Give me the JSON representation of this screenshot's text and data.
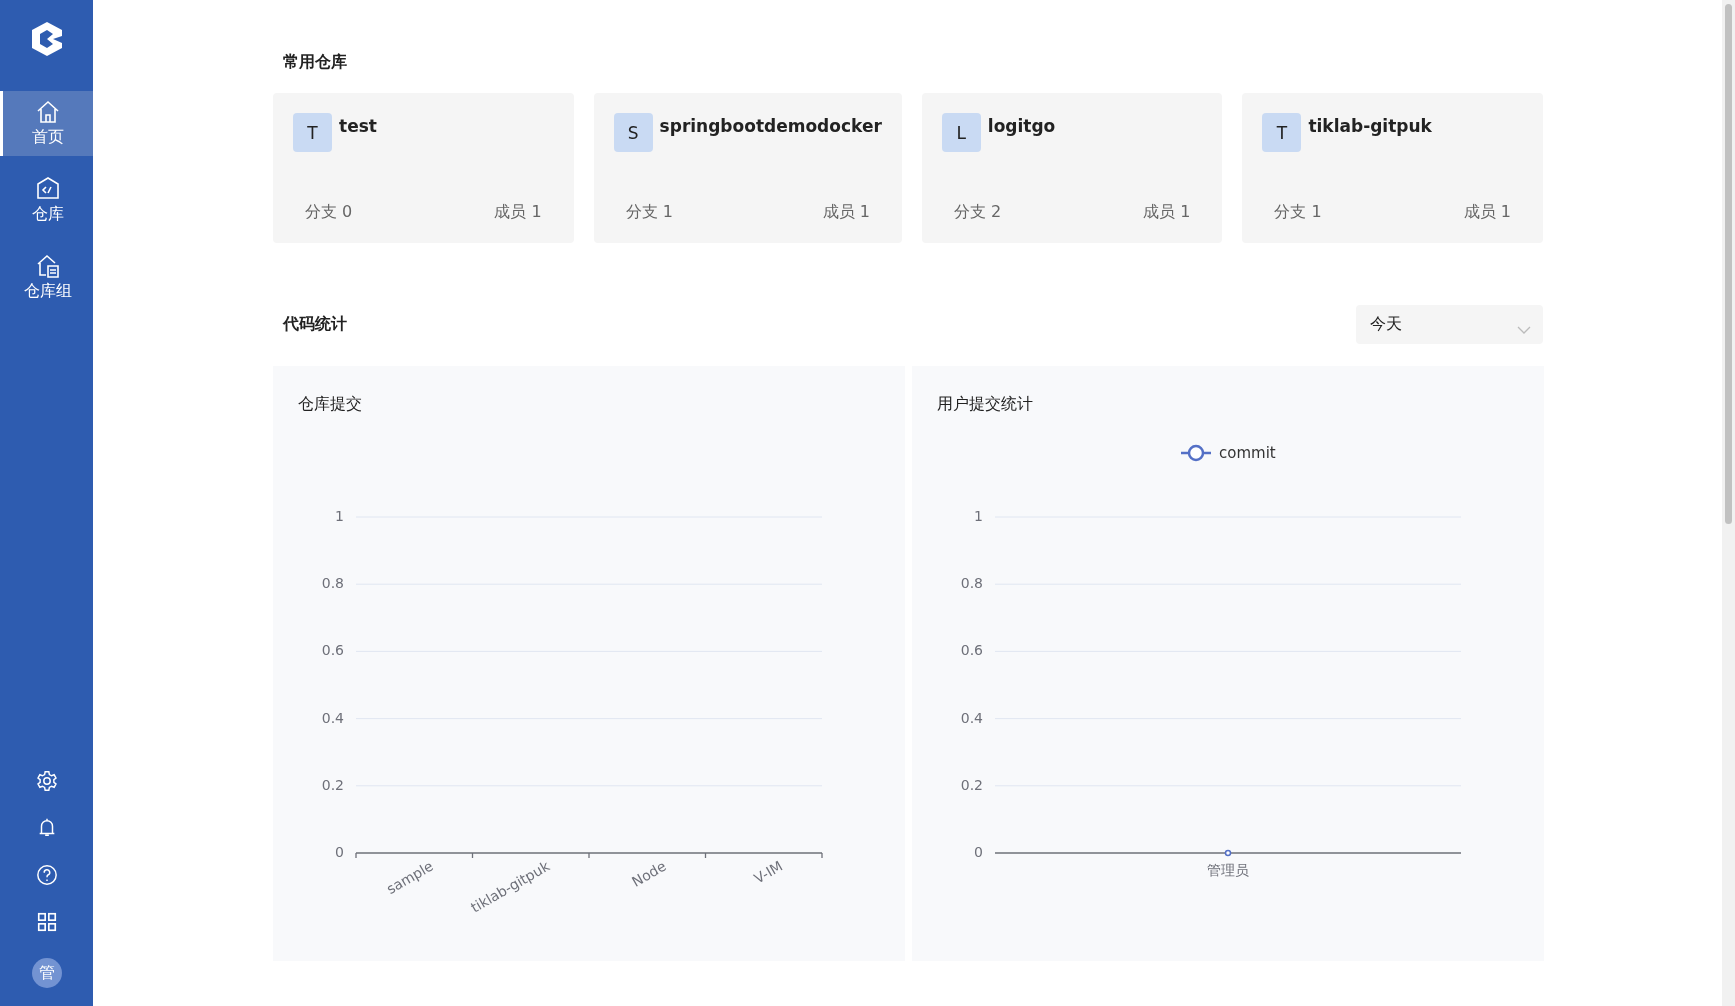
{
  "sidebar": {
    "items": [
      {
        "label": "首页",
        "selected": true
      },
      {
        "label": "仓库",
        "selected": false
      },
      {
        "label": "仓库组",
        "selected": false
      }
    ],
    "avatar": "管"
  },
  "favorites": {
    "title": "常用仓库",
    "repos": [
      {
        "initial": "T",
        "name": "test",
        "branches_label": "分支",
        "branches": "0",
        "members_label": "成员",
        "members": "1"
      },
      {
        "initial": "S",
        "name": "springbootdemodocker",
        "branches_label": "分支",
        "branches": "1",
        "members_label": "成员",
        "members": "1"
      },
      {
        "initial": "L",
        "name": "logitgo",
        "branches_label": "分支",
        "branches": "2",
        "members_label": "成员",
        "members": "1"
      },
      {
        "initial": "T",
        "name": "tiklab-gitpuk",
        "branches_label": "分支",
        "branches": "1",
        "members_label": "成员",
        "members": "1"
      }
    ]
  },
  "stats": {
    "title": "代码统计",
    "period": {
      "value": "今天"
    },
    "charts": [
      {
        "title": "仓库提交",
        "chart_data": {
          "type": "bar",
          "categories": [
            "sample",
            "tiklab-gitpuk",
            "Node",
            "V-IM"
          ],
          "values": [
            0,
            0,
            0,
            0
          ],
          "grid": true,
          "ylim": [
            0,
            1
          ],
          "yticks": [
            0,
            0.2,
            0.4,
            0.6,
            0.8,
            1
          ]
        }
      },
      {
        "title": "用户提交统计",
        "chart_data": {
          "type": "line",
          "x": [
            "管理员"
          ],
          "series": [
            {
              "name": "commit",
              "color": "#5470c6",
              "values": [
                0
              ],
              "marker": "circle"
            }
          ],
          "grid": true,
          "ylim": [
            0,
            1
          ],
          "yticks": [
            0,
            0.2,
            0.4,
            0.6,
            0.8,
            1
          ]
        }
      }
    ]
  }
}
